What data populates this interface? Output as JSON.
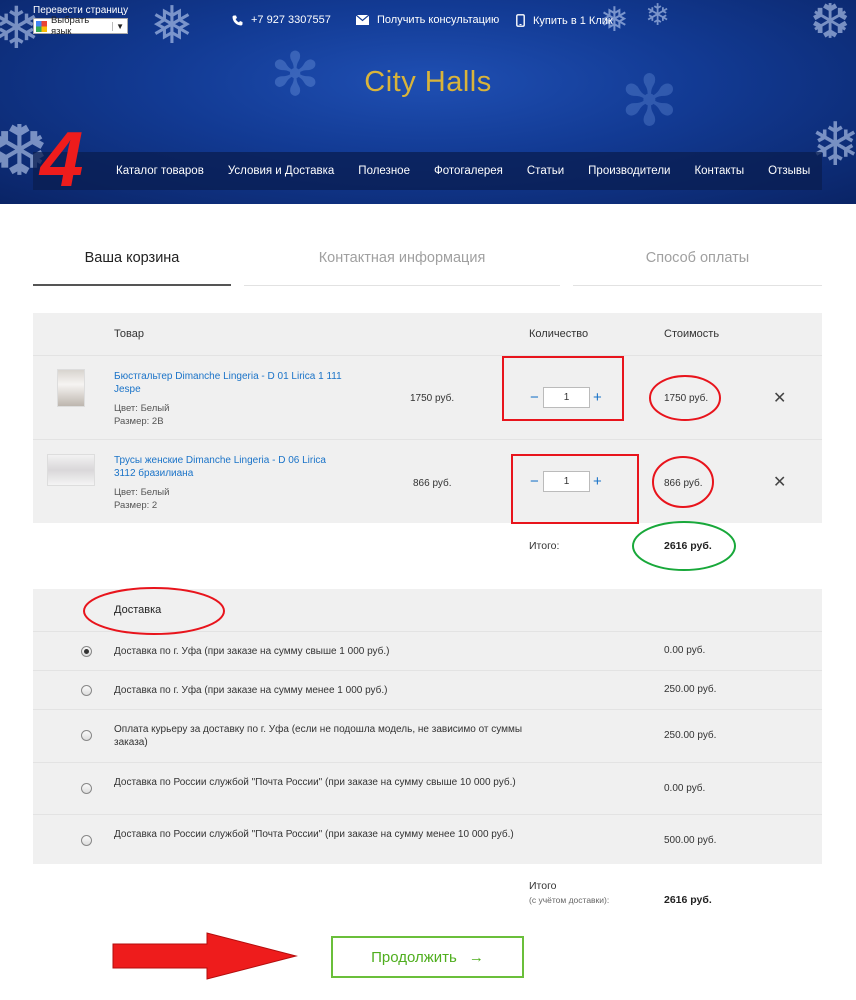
{
  "header": {
    "translate_label": "Перевести страницу",
    "language_select": "Выбрать язык",
    "phone": "+7 927 3307557",
    "consult": "Получить консультацию",
    "one_click": "Купить в 1 Клик",
    "brand": "City Halls",
    "annotation_number": "4"
  },
  "nav": {
    "items": [
      "Каталог товаров",
      "Условия и Доставка",
      "Полезное",
      "Фотогалерея",
      "Статьи",
      "Производители",
      "Контакты",
      "Отзывы"
    ]
  },
  "steps": [
    {
      "label": "Ваша корзина",
      "active": true
    },
    {
      "label": "Контактная информация",
      "active": false
    },
    {
      "label": "Способ оплаты",
      "active": false
    }
  ],
  "cart": {
    "col_product": "Товар",
    "col_qty": "Количество",
    "col_cost": "Стоимость",
    "items": [
      {
        "name": "Бюстгальтер Dimanche Lingeria - D 01 Lirica 1 111 Jespe",
        "color": "Цвет: Белый",
        "size": "Размер: 2B",
        "price": "1750 руб.",
        "qty": "1",
        "cost": "1750 руб."
      },
      {
        "name": "Трусы женские Dimanche Lingeria - D 06 Lirica 3112 бразилиана",
        "color": "Цвет: Белый",
        "size": "Размер: 2",
        "price": "866 руб.",
        "qty": "1",
        "cost": "866 руб."
      }
    ],
    "total_label": "Итого:",
    "total_value": "2616 руб."
  },
  "delivery": {
    "title": "Доставка",
    "options": [
      {
        "label": "Доставка по г. Уфа (при заказе на сумму свыше 1 000 руб.)",
        "price": "0.00 руб.",
        "checked": true
      },
      {
        "label": "Доставка по г. Уфа (при заказе на сумму менее 1 000 руб.)",
        "price": "250.00 руб.",
        "checked": false
      },
      {
        "label": "Оплата курьеру за доставку по г. Уфа (если не подошла модель, не зависимо от суммы заказа)",
        "price": "250.00 руб.",
        "checked": false
      },
      {
        "label": "Доставка по России службой \"Почта России\" (при заказе на сумму свыше 10 000 руб.)",
        "price": "0.00 руб.",
        "checked": false
      },
      {
        "label": "Доставка по России службой \"Почта России\" (при заказе на сумму менее 10 000 руб.)",
        "price": "500.00 руб.",
        "checked": false
      }
    ]
  },
  "grand_total": {
    "label": "Итого",
    "sub": "(с учётом доставки):",
    "value": "2616 руб."
  },
  "continue_label": "Продолжить",
  "continue_arrow": "→",
  "colors": {
    "header_blue": "#123a93",
    "brand_gold": "#d9b43a",
    "link_blue": "#1a73c8",
    "button_green": "#4fae1e",
    "annotation_red": "#ee1c1c",
    "annotation_green": "#18a83a"
  }
}
